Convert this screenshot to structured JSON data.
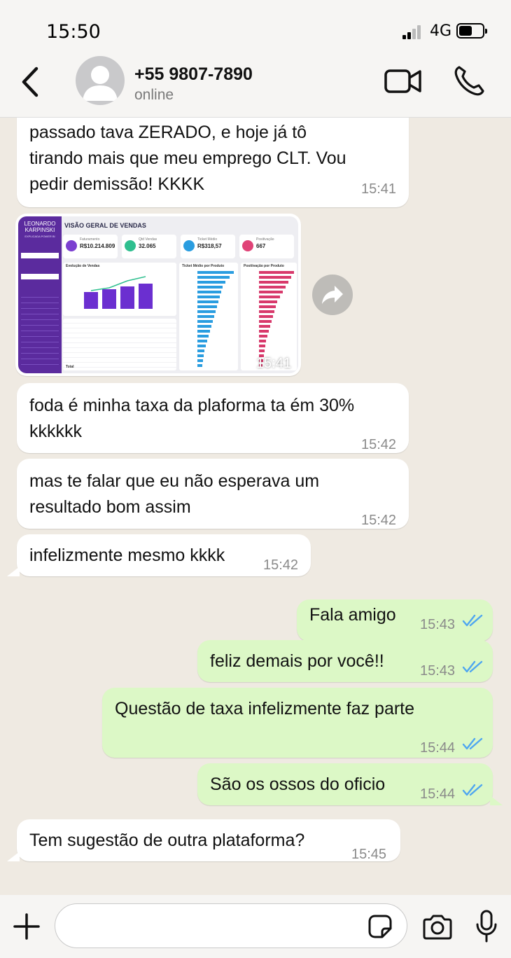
{
  "status_bar": {
    "time": "15:50",
    "network": "4G",
    "battery_level": 0.55
  },
  "header": {
    "contact_name": "+55 9807-7890",
    "contact_status": "online",
    "icons": [
      "back-icon",
      "avatar-placeholder-icon",
      "video-call-icon",
      "phone-icon"
    ]
  },
  "messages": [
    {
      "side": "in",
      "lines": [
        "passado tava ZERADO, e hoje já tô",
        "tirando mais que meu emprego CLT. Vou",
        "pedir demissão! KKKK"
      ],
      "time": "15:41"
    },
    {
      "side": "in",
      "type": "image",
      "time": "15:41",
      "image": {
        "brand": "LEONARDO KARPINSKI",
        "brand_sub": "EXPLICADA POWER BI",
        "title": "VISÃO GERAL DE VENDAS",
        "kpis": [
          {
            "label": "Faturamento",
            "value": "R$10.214.809",
            "color": "#7b3fd0"
          },
          {
            "label": "Qtd Vendas",
            "value": "32.065",
            "color": "#2fbf8f"
          },
          {
            "label": "Ticket Médio",
            "value": "R$318,57",
            "color": "#2a9de0"
          },
          {
            "label": "Positivação",
            "value": "667",
            "color": "#e04377"
          }
        ],
        "panels": {
          "evolution": "Evolução de Vendas",
          "ticket": "Ticket Médio por Produto",
          "positivation": "Positivação por Produto"
        },
        "table_total": "Total"
      }
    },
    {
      "side": "in",
      "lines": [
        "foda é minha taxa da plaforma ta ém 30%",
        "kkkkkk"
      ],
      "time": "15:42"
    },
    {
      "side": "in",
      "lines": [
        "mas te falar que eu não esperava um",
        "resultado bom assim"
      ],
      "time": "15:42"
    },
    {
      "side": "in",
      "lines": [
        "infelizmente mesmo kkkk"
      ],
      "time": "15:42"
    },
    {
      "side": "out",
      "lines": [
        "Fala amigo"
      ],
      "time": "15:43",
      "read": true
    },
    {
      "side": "out",
      "lines": [
        "feliz demais por você!!"
      ],
      "time": "15:43",
      "read": true
    },
    {
      "side": "out",
      "lines": [
        "Questão de taxa infelizmente faz parte"
      ],
      "time": "15:44",
      "read": true
    },
    {
      "side": "out",
      "lines": [
        "São os ossos do oficio"
      ],
      "time": "15:44",
      "read": true
    },
    {
      "side": "in",
      "lines": [
        "Tem sugestão de outra plataforma?"
      ],
      "time": "15:45"
    }
  ],
  "input_bar": {
    "placeholder": "",
    "icons": [
      "plus-icon",
      "sticker-icon",
      "camera-icon",
      "microphone-icon"
    ]
  },
  "colors": {
    "outgoing_bubble": "#dcf8c6",
    "incoming_bubble": "#ffffff",
    "read_ticks": "#4fa6f0",
    "chat_background": "#efeae2"
  }
}
